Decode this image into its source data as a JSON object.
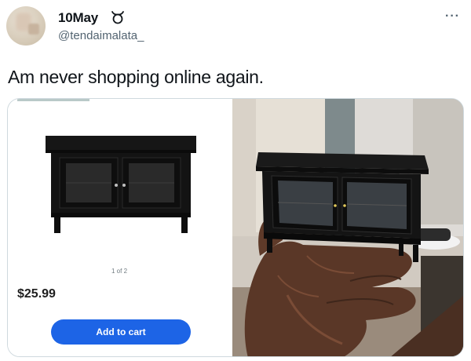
{
  "tweet": {
    "display_name": "10May",
    "name_emoji": "zodiac-taurus-icon",
    "handle": "@tendaimalata_",
    "more": "···",
    "text": "Am never shopping online again."
  },
  "product": {
    "page_indicator": "1 of 2",
    "price": "$25.99",
    "add_to_cart": "Add to cart",
    "button_color": "#1d64e6"
  }
}
